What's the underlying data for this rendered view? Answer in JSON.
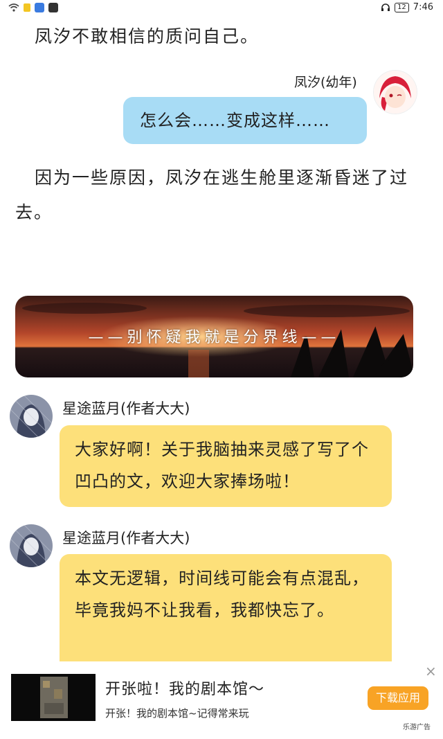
{
  "statusbar": {
    "battery": "12",
    "time": "7:46"
  },
  "narration": {
    "line1": "凤汐不敢相信的质问自己。",
    "line2": "因为一些原因，凤汐在逃生舱里逐渐昏迷了过去。"
  },
  "chat1": {
    "speaker": "凤汐(幼年)",
    "text": "怎么会……变成这样……"
  },
  "divider": {
    "text": "——别怀疑我就是分界线——"
  },
  "chat2": {
    "speaker": "星途蓝月(作者大大)",
    "text": "大家好啊！关于我脑抽来灵感了写了个凹凸的文，欢迎大家捧场啦！"
  },
  "chat3": {
    "speaker": "星途蓝月(作者大大)",
    "text": "本文无逻辑，时间线可能会有点混乱，毕竟我妈不让我看，我都快忘了。"
  },
  "ad": {
    "title": "开张啦！我的剧本馆～",
    "subtitle": "开张！我的剧本馆~记得常来玩",
    "button": "下载应用",
    "close": "×",
    "tag": "乐游广告"
  },
  "colors": {
    "blue_bubble": "#a8dcf5",
    "yellow_bubble": "#fde07a",
    "ad_button": "#f8a325"
  },
  "icons": [
    "wifi-icon",
    "signal-icon",
    "message-app-icon",
    "video-app-icon",
    "headphones-icon",
    "battery-icon",
    "close-icon"
  ]
}
